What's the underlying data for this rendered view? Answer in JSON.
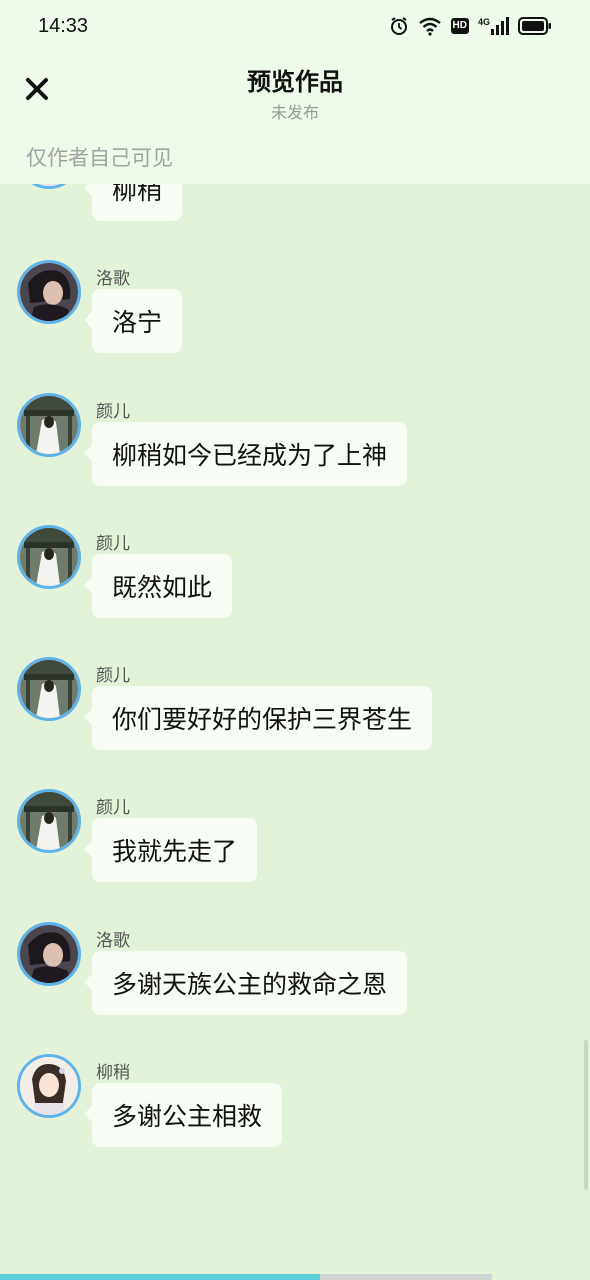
{
  "status_bar": {
    "time": "14:33",
    "icons": [
      "alarm-icon",
      "wifi-icon",
      "hd-icon",
      "signal-4g-icon",
      "battery-icon"
    ],
    "hd_label": "HD",
    "network_label": "4G"
  },
  "header": {
    "title": "预览作品",
    "subtitle": "未发布",
    "visibility_note": "仅作者自己可见",
    "close_icon": "close-icon"
  },
  "messages": [
    {
      "sender": "",
      "text": "柳稍",
      "avatar": "liushao"
    },
    {
      "sender": "洛歌",
      "text": "洛宁",
      "avatar": "luoge"
    },
    {
      "sender": "颜儿",
      "text": "柳稍如今已经成为了上神",
      "avatar": "yaner"
    },
    {
      "sender": "颜儿",
      "text": "既然如此",
      "avatar": "yaner"
    },
    {
      "sender": "颜儿",
      "text": "你们要好好的保护三界苍生",
      "avatar": "yaner"
    },
    {
      "sender": "颜儿",
      "text": "我就先走了",
      "avatar": "yaner"
    },
    {
      "sender": "洛歌",
      "text": "多谢天族公主的救命之恩",
      "avatar": "luoge"
    },
    {
      "sender": "柳稍",
      "text": "多谢公主相救",
      "avatar": "liushao"
    }
  ],
  "progress": {
    "value": 0.65
  },
  "colors": {
    "background": "#e3f3da",
    "header_bg": "#eefaea",
    "avatar_border": "#5fb3e8",
    "bubble_bg": "#f7fcf4",
    "progress_fill": "#5ccfd8"
  }
}
